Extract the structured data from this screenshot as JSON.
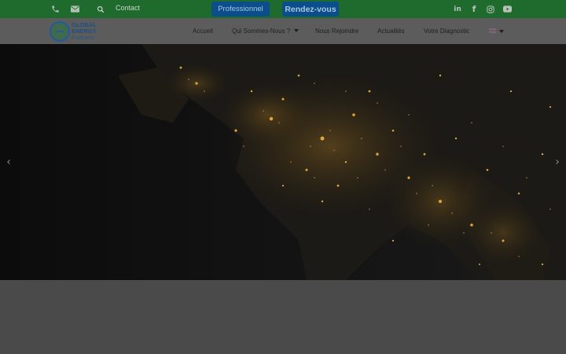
{
  "topbar": {
    "phone_icon": "phone-icon",
    "mail_icon": "envelope-icon",
    "search_icon": "search-icon",
    "contact_label": "Contact",
    "btn_pro_label": "Professionnel",
    "btn_rdv_label": "Rendez-vous",
    "social": [
      "linkedin-icon",
      "facebook-icon",
      "instagram-icon",
      "youtube-icon"
    ],
    "colors": {
      "background": "#1f6b2e",
      "button": "#0a4f8c"
    }
  },
  "logo": {
    "line1": "GLOBAL",
    "line2": "ENERGY",
    "line3": "Partners"
  },
  "nav": {
    "items": [
      {
        "label": "Accueil"
      },
      {
        "label": "Qui Sommes-Nous ?"
      },
      {
        "label": "Nous Rejoindre"
      },
      {
        "label": "Actualités"
      },
      {
        "label": "Votre Diagnostic"
      }
    ],
    "language_flag": "uk-flag-icon"
  },
  "hero": {
    "image": "night-satellite-view-of-europe",
    "prev_icon": "chevron-left-icon",
    "next_icon": "chevron-right-icon"
  }
}
